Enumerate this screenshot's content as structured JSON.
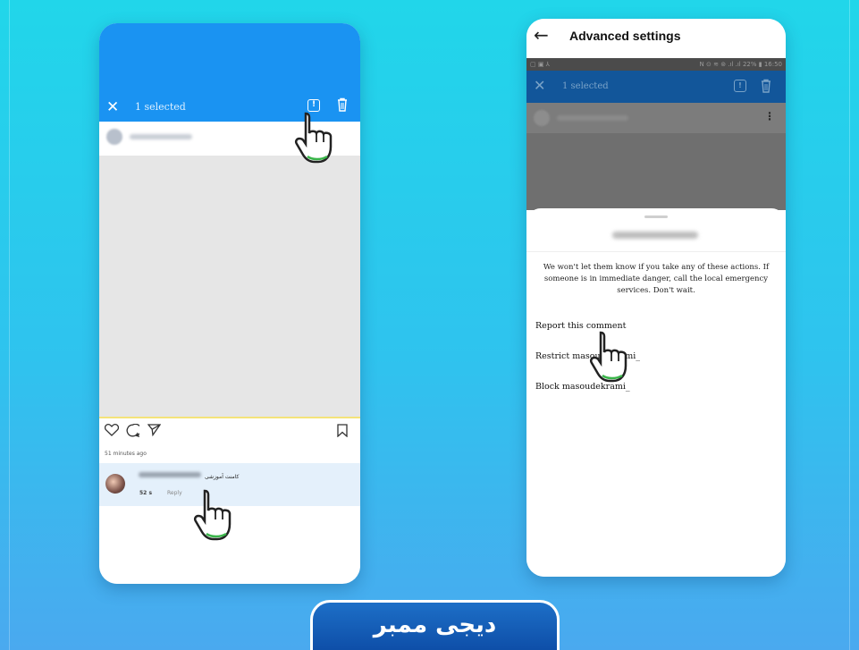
{
  "left_phone": {
    "close_glyph": "✕",
    "selected_label": "1 selected",
    "report_glyph": "!",
    "time_ago": "51 minutes ago",
    "comment": {
      "text": "کامنت آموزشی",
      "likes": "52 s",
      "reply_label": "Reply"
    }
  },
  "right_phone": {
    "back_glyph": "←",
    "title": "Advanced settings",
    "status_left": "▢ ▣ ⅄",
    "status_right": "N ⊙ ≋ ⊚ .ıl .ıl 22% ▮ 16:50",
    "close_glyph": "✕",
    "selected_label": "1 selected",
    "report_glyph": "!",
    "menu_dots": "⋮",
    "notice": "We won't let them know if you take any of these actions. If someone is in immediate danger, call the local emergency services. Don't wait.",
    "options": [
      "Report this comment",
      "Restrict masoudekrami_",
      "Block masoudekrami_"
    ]
  },
  "logo": {
    "text": "دیجی ممبر"
  },
  "colors": {
    "instagram_blue": "#1a93f2",
    "dark_select_bar": "#12569a",
    "logo_blue": "#0d4ca6"
  }
}
